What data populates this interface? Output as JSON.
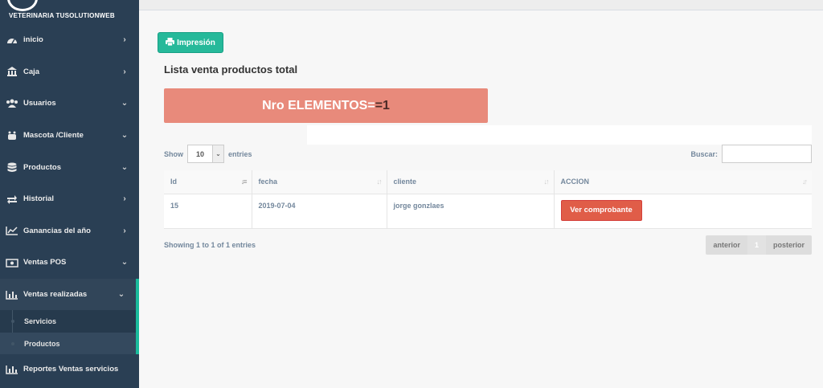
{
  "sidebar": {
    "brand": "VETERINARIA TUSOLUTIONWEB",
    "items": [
      {
        "label": "inicio",
        "icon": "dashboard-icon",
        "chevron": "›"
      },
      {
        "label": "Caja",
        "icon": "bank-icon",
        "chevron": "›"
      },
      {
        "label": "Usuarios",
        "icon": "users-icon",
        "chevron": "⌄"
      },
      {
        "label": "Mascota /Cliente",
        "icon": "paw-icon",
        "chevron": "⌄"
      },
      {
        "label": "Productos",
        "icon": "database-icon",
        "chevron": "⌄"
      },
      {
        "label": "Historial",
        "icon": "exchange-icon",
        "chevron": "›"
      },
      {
        "label": "Ganancias del año",
        "icon": "line-chart-icon",
        "chevron": "›"
      },
      {
        "label": "Ventas POS",
        "icon": "money-icon",
        "chevron": "⌄"
      },
      {
        "label": "Ventas realizadas",
        "icon": "bar-chart-icon",
        "chevron": "⌄"
      }
    ],
    "submenu": [
      {
        "label": "Servicios"
      },
      {
        "label": "Productos"
      }
    ],
    "last_item": {
      "label": "Reportes Ventas servicios",
      "icon": "bar-chart-icon"
    }
  },
  "main": {
    "print_button": "Impresión",
    "title": "Lista venta productos total",
    "nro_label": "Nro ELEMENTOS= ",
    "nro_count": "=1",
    "show_label": "Show",
    "entries_value": "10",
    "entries_label": "entries",
    "search_label": "Buscar:",
    "search_value": "",
    "table": {
      "headers": [
        "Id",
        "fecha",
        "cliente",
        "ACCION"
      ],
      "rows": [
        {
          "id": "15",
          "fecha": "2019-07-04",
          "cliente": "jorge gonzlaes",
          "action": "Ver comprobante"
        }
      ]
    },
    "info": "Showing 1 to 1 of 1 entries",
    "pager": {
      "prev": "anterior",
      "page": "1",
      "next": "posterior"
    }
  },
  "colors": {
    "sidebar_bg": "#2a3f54",
    "accent": "#1abb9c",
    "print_button": "#26b99a",
    "nro_box": "#e88a7b",
    "action_button": "#e05d48"
  }
}
